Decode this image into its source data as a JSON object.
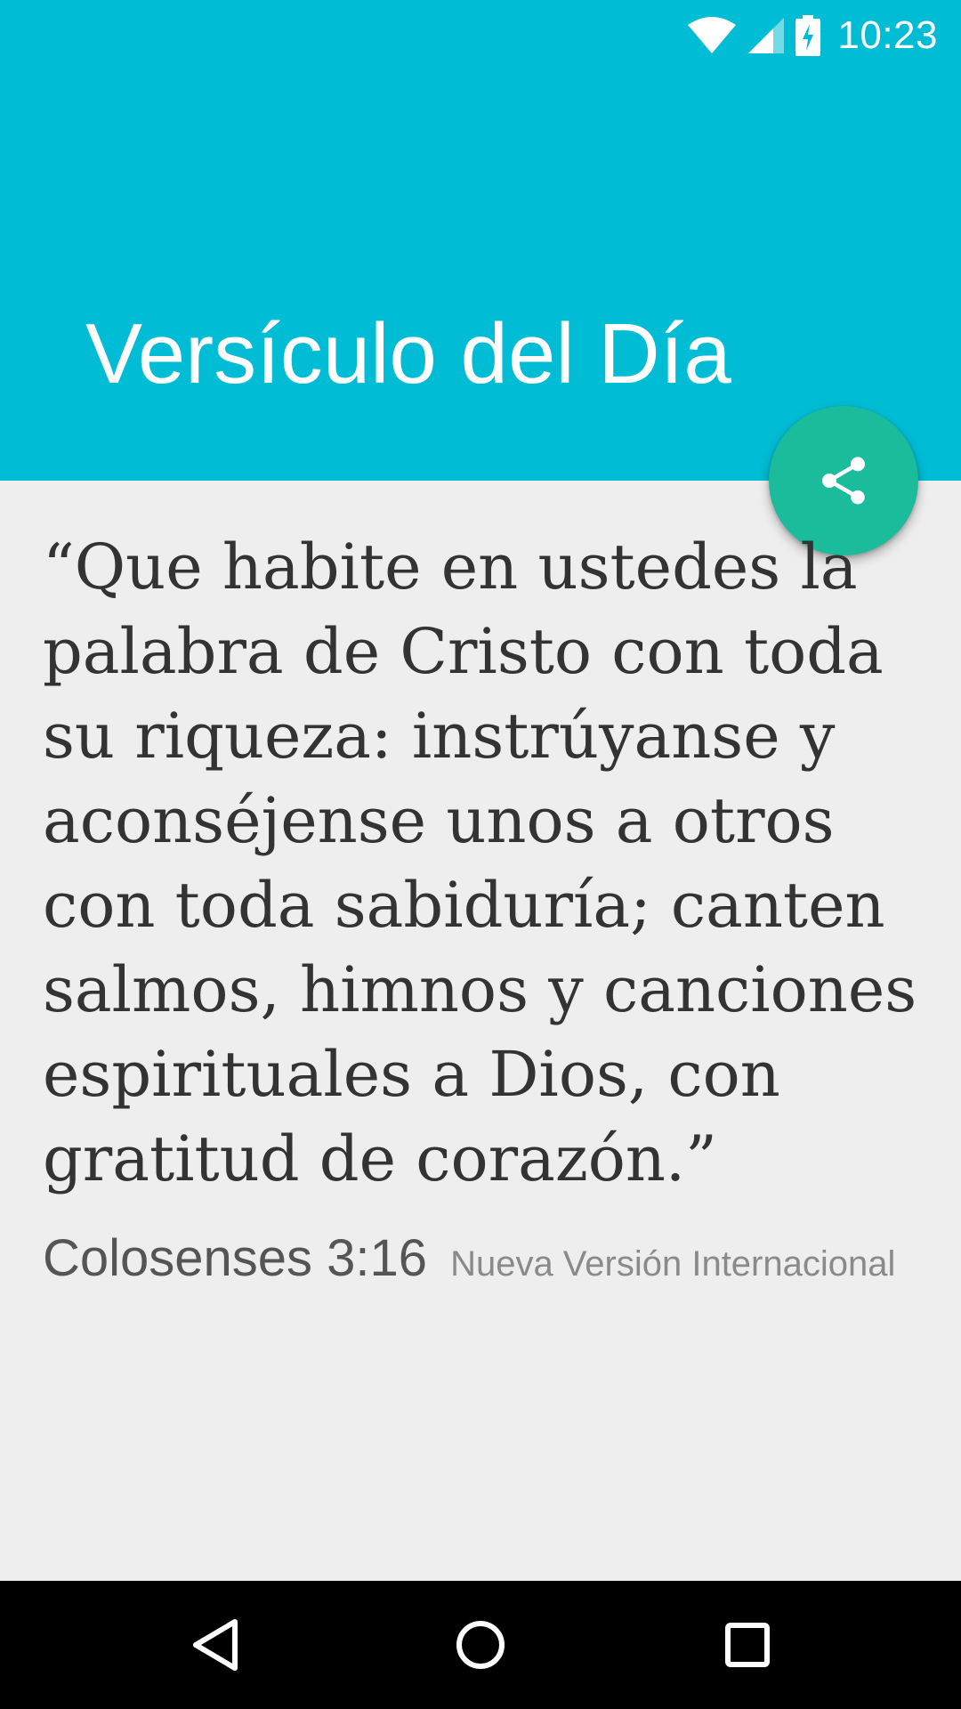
{
  "status_bar": {
    "time": "10:23",
    "icons": [
      "wifi-icon",
      "cell-signal-icon",
      "battery-charging-icon"
    ]
  },
  "header": {
    "title": "Versículo del Día",
    "background_color": "#00bcd4"
  },
  "share_button": {
    "icon": "share-icon",
    "color": "#1abc9c"
  },
  "verse": {
    "text": "“Que habite en ustedes la palabra de Cristo con toda su riqueza: instrúyanse y aconséjense unos a otros con toda sabiduría; canten salmos, himnos y canciones espirituales a Dios, con gratitud de corazón.”",
    "reference": "Colosenses 3:16",
    "version": "Nueva Versión Internacional"
  },
  "nav_bar": {
    "buttons": [
      "back-icon",
      "home-icon",
      "recents-icon"
    ]
  }
}
